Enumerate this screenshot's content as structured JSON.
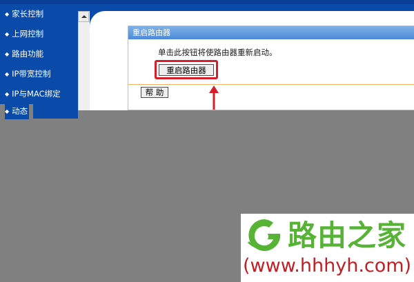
{
  "sidebar": {
    "items": [
      {
        "label": "家长控制"
      },
      {
        "label": "上网控制"
      },
      {
        "label": "路由功能"
      },
      {
        "label": "IP带宽控制"
      },
      {
        "label": "IP与MAC绑定"
      },
      {
        "label": "动态"
      }
    ]
  },
  "panel": {
    "title": "重启路由器",
    "description": "单击此按钮将使路由器重新启动。",
    "restart_button": "重启路由器",
    "help_button": "帮 助"
  },
  "watermark": {
    "brand": "路由之家",
    "url": "(www.hhhyh.com)"
  },
  "colors": {
    "sidebar_blue": "#0a4aa8",
    "panel_title_blue": "#5b97dd",
    "panel_border": "#f2b566",
    "highlight_red": "#d61e2a",
    "logo_green": "#56b336",
    "logo_red": "#c21e24"
  }
}
